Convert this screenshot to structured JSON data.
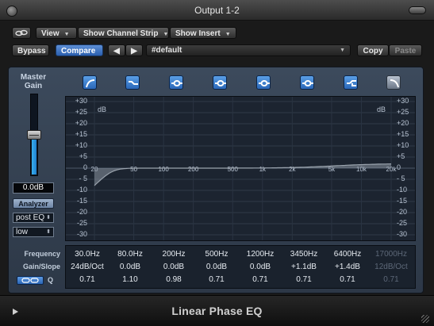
{
  "window": {
    "title": "Output 1-2"
  },
  "toolbar": {
    "view": "View",
    "show_channel_strip": "Show Channel Strip",
    "show_insert": "Show Insert",
    "bypass": "Bypass",
    "compare": "Compare",
    "prev_icon": "left-arrow-icon",
    "next_icon": "right-arrow-icon",
    "preset": "#default",
    "copy": "Copy",
    "paste": "Paste"
  },
  "master_gain": {
    "label_line1": "Master",
    "label_line2": "Gain",
    "value": "0.0dB",
    "level_fraction": 0.5,
    "analyzer": "Analyzer",
    "analyzer_mode": "post EQ",
    "resolution": "low"
  },
  "band_buttons": [
    {
      "name": "low-cut",
      "on": true
    },
    {
      "name": "low-shelf",
      "on": true
    },
    {
      "name": "parametric-1",
      "on": true
    },
    {
      "name": "parametric-2",
      "on": true
    },
    {
      "name": "parametric-3",
      "on": true
    },
    {
      "name": "parametric-4",
      "on": true
    },
    {
      "name": "high-shelf",
      "on": true
    },
    {
      "name": "high-cut",
      "on": false
    }
  ],
  "display": {
    "unit_left": "dB",
    "unit_right": "dB",
    "db_ticks": [
      "+30",
      "+25",
      "+20",
      "+15",
      "+10",
      "+5",
      "0",
      "- 5",
      "-10",
      "-15",
      "-20",
      "-25",
      "-30"
    ],
    "freq_ticks": [
      "20",
      "50",
      "100",
      "200",
      "500",
      "1k",
      "2k",
      "5k",
      "10k",
      "20k"
    ]
  },
  "bands": {
    "labels": {
      "frequency": "Frequency",
      "gain_slope": "Gain/Slope",
      "q": "Q"
    },
    "frequency": [
      "30.0Hz",
      "80.0Hz",
      "200Hz",
      "500Hz",
      "1200Hz",
      "3450Hz",
      "6400Hz",
      "17000Hz"
    ],
    "gain": [
      "24dB/Oct",
      "0.0dB",
      "0.0dB",
      "0.0dB",
      "0.0dB",
      "+1.1dB",
      "+1.4dB",
      "12dB/Oct"
    ],
    "q": [
      "0.71",
      "1.10",
      "0.98",
      "0.71",
      "0.71",
      "0.71",
      "0.71",
      "0.71"
    ],
    "active": [
      true,
      true,
      true,
      true,
      true,
      true,
      true,
      false
    ]
  },
  "footer": {
    "plugin_name": "Linear Phase EQ"
  },
  "colors": {
    "accent": "#3a8fe0",
    "curve": "#9aa3ad",
    "panel": "#35414f"
  }
}
